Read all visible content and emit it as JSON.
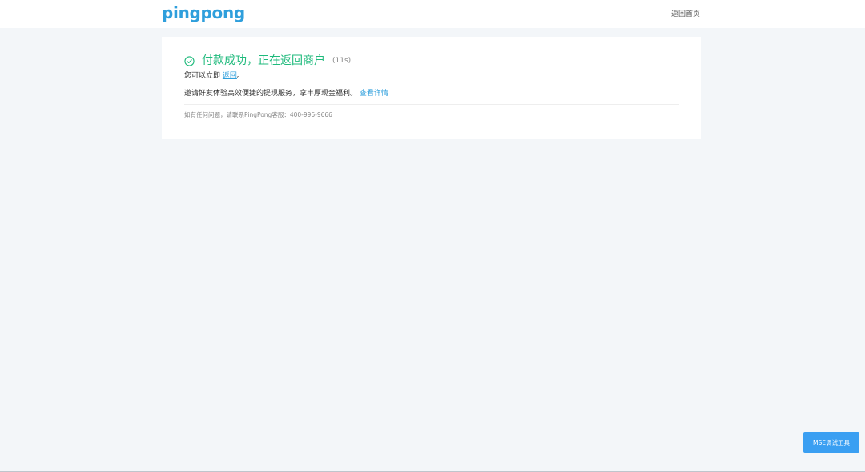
{
  "header": {
    "logo_text": "pingpong",
    "home_link": "返回首页"
  },
  "result": {
    "title": "付款成功，正在返回商户",
    "countdown": "(11s)",
    "return_prefix": "您可以立即",
    "return_link": "返回",
    "return_suffix": "。",
    "invite_text": "邀请好友体验高效便捷的提现服务，拿丰厚现金福利。",
    "details_link": "查看详情",
    "contact": "如有任何问题，请联系PingPong客服：400-996-9666"
  },
  "tools": {
    "mse_button": "MSE调试工具"
  },
  "colors": {
    "brand": "#2f9fdc",
    "success": "#1fba7c",
    "page_bg": "#f3f6f9",
    "tool_button": "#3a9ff2"
  },
  "icons": {
    "success": "check-circle-icon"
  }
}
